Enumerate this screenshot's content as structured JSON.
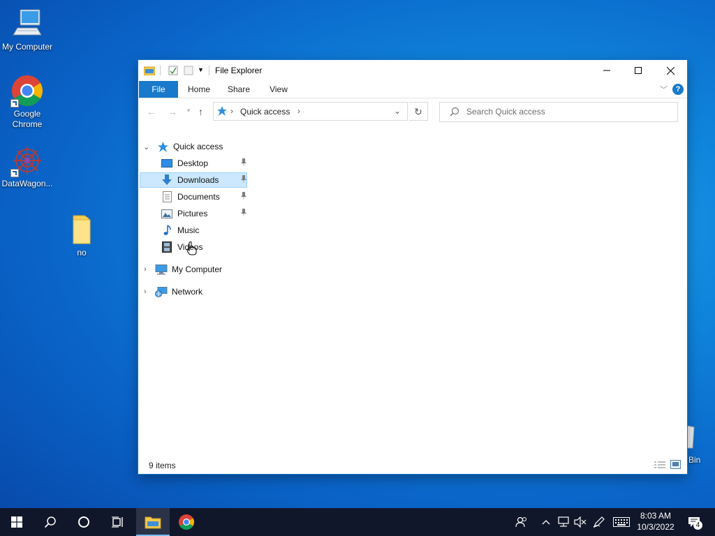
{
  "desktop": {
    "icons": [
      {
        "label": "My Computer",
        "icon": "computer-icon"
      },
      {
        "label": "Google Chrome",
        "icon": "chrome-icon"
      },
      {
        "label": "DataWagon...",
        "icon": "datawagon-icon"
      },
      {
        "label": "no",
        "icon": "folder-icon"
      }
    ],
    "recycle_bin_label": "Bin"
  },
  "window": {
    "title": "File Explorer",
    "ribbon_tabs": [
      "File",
      "Home",
      "Share",
      "View"
    ],
    "address": {
      "crumb": "Quick access"
    },
    "search": {
      "placeholder": "Search Quick access"
    },
    "tree": {
      "quick_access": "Quick access",
      "items": [
        {
          "label": "Desktop",
          "icon": "desktop-icon",
          "pinned": true
        },
        {
          "label": "Downloads",
          "icon": "download-arrow-icon",
          "pinned": true,
          "selected": true
        },
        {
          "label": "Documents",
          "icon": "document-icon",
          "pinned": true
        },
        {
          "label": "Pictures",
          "icon": "pictures-icon",
          "pinned": true
        },
        {
          "label": "Music",
          "icon": "music-note-icon",
          "pinned": false
        },
        {
          "label": "Videos",
          "icon": "film-icon",
          "pinned": false
        }
      ],
      "my_computer": "My Computer",
      "network": "Network"
    },
    "status": {
      "items_count": "9 items"
    }
  },
  "taskbar": {
    "clock": {
      "time": "8:03 AM",
      "date": "10/3/2022"
    },
    "notification_count": "4"
  },
  "colors": {
    "accent": "#1979ca",
    "selection": "#cce8ff",
    "taskbar": "#11172a"
  }
}
